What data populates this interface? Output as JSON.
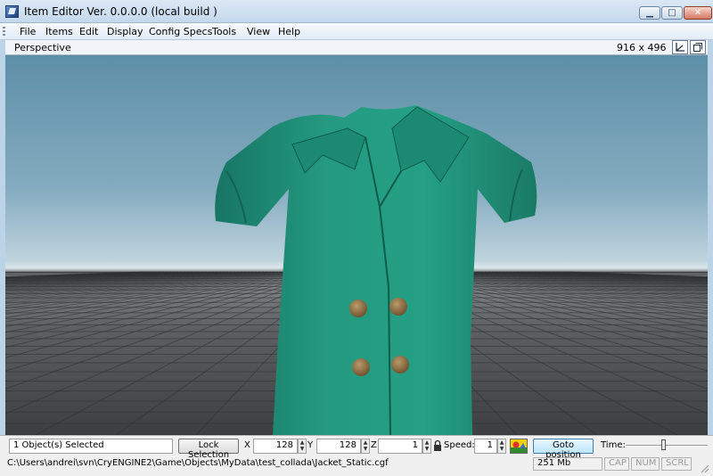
{
  "window": {
    "title": "Item Editor Ver. 0.0.0.0 (local build )",
    "minimize": "▁",
    "maximize": "□",
    "close": "✕"
  },
  "menu": [
    "File",
    "Items",
    "Edit",
    "Display",
    "Config Specs",
    "Tools",
    "View",
    "Help"
  ],
  "viewport": {
    "name": "Perspective",
    "resolution": "916 x 496",
    "icons": [
      "axis-gizmo-icon",
      "maximize-viewport-icon"
    ]
  },
  "scene": {
    "object": "jacket",
    "jacket_color": "#1f8f78",
    "button_color": "#8a6a3f",
    "sky_top": "#5d8fa8",
    "ground": "#4a4d50"
  },
  "statusbar": {
    "selection": "1 Object(s) Selected",
    "lock_selection": "Lock Selection",
    "x_label": "X",
    "x_value": "128",
    "y_label": "Y",
    "y_value": "128",
    "z_label": "Z",
    "z_value": "1",
    "speed_label": "Speed:",
    "speed_value": "1",
    "goto_position": "Goto position",
    "time_label": "Time:",
    "path": "C:\\Users\\andrei\\svn\\CryENGINE2\\Game\\Objects\\MyData\\test_collada\\Jacket_Static.cgf",
    "memory": "251 Mb",
    "cap": "CAP",
    "num": "NUM",
    "scrl": "SCRL"
  }
}
